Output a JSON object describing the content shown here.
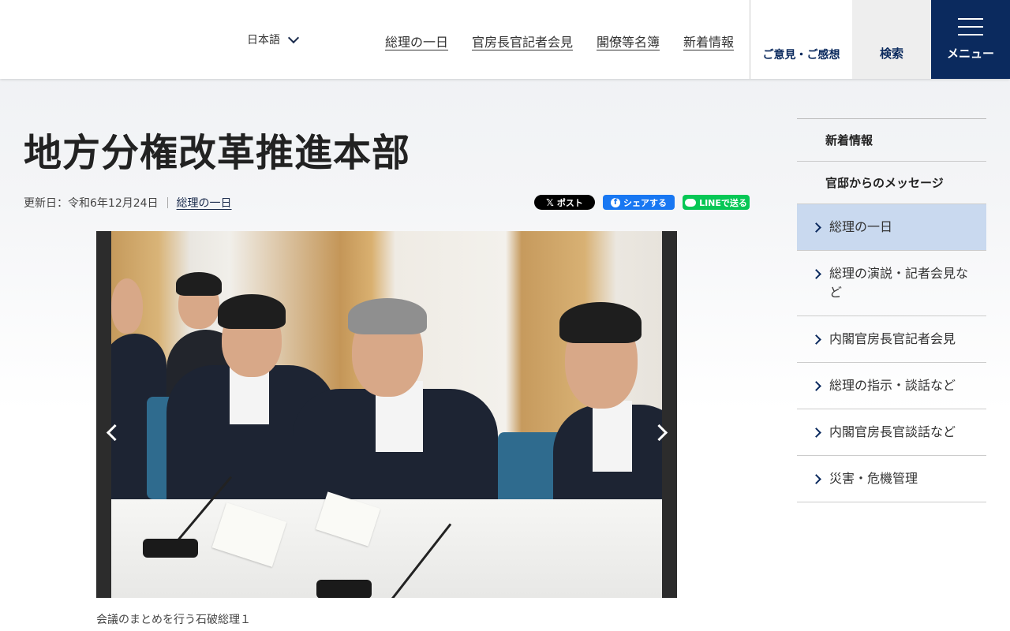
{
  "header": {
    "language_label": "日本語",
    "nav": [
      "総理の一日",
      "官房長官記者会見",
      "閣僚等名簿",
      "新着情報"
    ],
    "opinion_label": "ご意見・ご感想",
    "search_label": "検索",
    "menu_label": "メニュー"
  },
  "page": {
    "title": "地方分権改革推進本部",
    "updated": "更新日：令和6年12月24日",
    "category_link": "総理の一日"
  },
  "share": {
    "x_label": "ポスト",
    "facebook_label": "シェアする",
    "line_label": "LINEで送る"
  },
  "photo": {
    "caption": "会議のまとめを行う石破総理１"
  },
  "sidebar": {
    "headings": [
      "新着情報",
      "官邸からのメッセージ"
    ],
    "items": [
      {
        "label": "総理の一日",
        "active": true
      },
      {
        "label": "総理の演説・記者会見など",
        "active": false
      },
      {
        "label": "内閣官房長官記者会見",
        "active": false
      },
      {
        "label": "総理の指示・談話など",
        "active": false
      },
      {
        "label": "内閣官房長官談話など",
        "active": false
      },
      {
        "label": "災害・危機管理",
        "active": false
      }
    ]
  },
  "colors": {
    "navy": "#0b2a5e",
    "active_item_bg": "#c9d9ef",
    "facebook": "#1877f2",
    "line": "#06c755"
  }
}
